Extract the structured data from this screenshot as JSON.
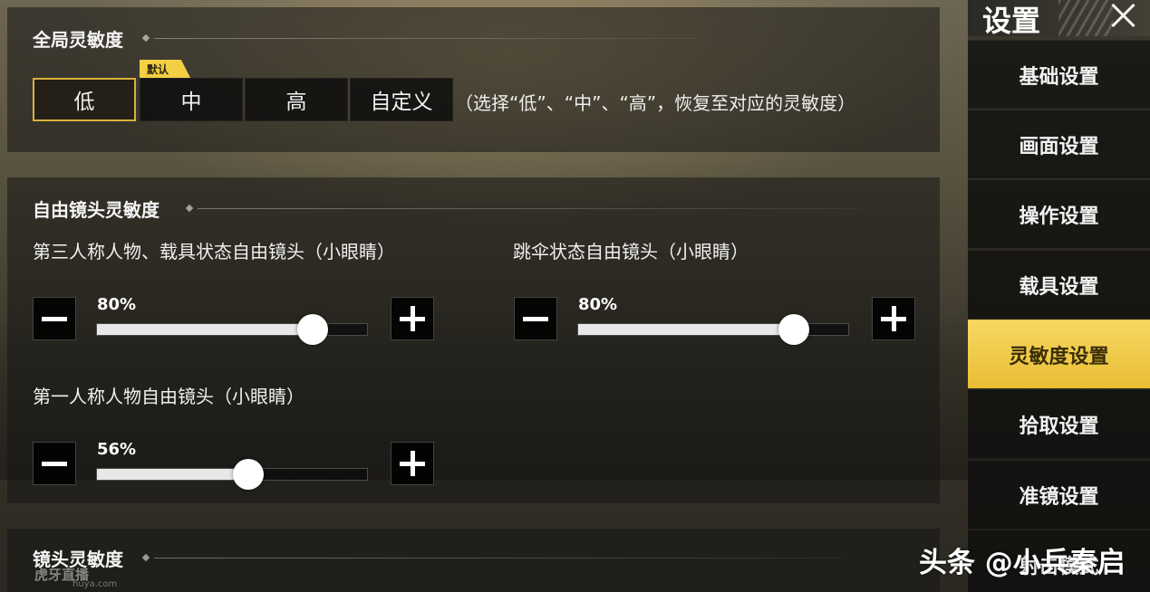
{
  "sidebar": {
    "title": "设置",
    "items": [
      {
        "label": "基础设置",
        "active": false
      },
      {
        "label": "画面设置",
        "active": false
      },
      {
        "label": "操作设置",
        "active": false
      },
      {
        "label": "载具设置",
        "active": false
      },
      {
        "label": "灵敏度设置",
        "active": true
      },
      {
        "label": "拾取设置",
        "active": false
      },
      {
        "label": "准镜设置",
        "active": false
      },
      {
        "label": "射击模式",
        "active": false
      }
    ]
  },
  "global_sensitivity": {
    "title": "全局灵敏度",
    "default_tag": "默认",
    "options": [
      "低",
      "中",
      "高",
      "自定义"
    ],
    "selected": "低",
    "hint": "（选择“低”、“中”、“高”，恢复至对应的灵敏度）"
  },
  "free_camera": {
    "title": "自由镜头灵敏度",
    "sliders": [
      {
        "label": "第三人称人物、载具状态自由镜头（小眼睛）",
        "value_text": "80%",
        "value": 0.8
      },
      {
        "label": "跳伞状态自由镜头（小眼睛）",
        "value_text": "80%",
        "value": 0.8
      },
      {
        "label": "第一人称人物自由镜头（小眼睛）",
        "value_text": "56%",
        "value": 0.56
      }
    ]
  },
  "lens_sensitivity": {
    "title": "镜头灵敏度"
  },
  "watermarks": {
    "stream_logo": "虎牙直播",
    "stream_url": "huya.com",
    "author": "头条 @小兵秦启"
  },
  "colors": {
    "accent": "#e9bd34",
    "selected_border": "#d9b23c"
  }
}
